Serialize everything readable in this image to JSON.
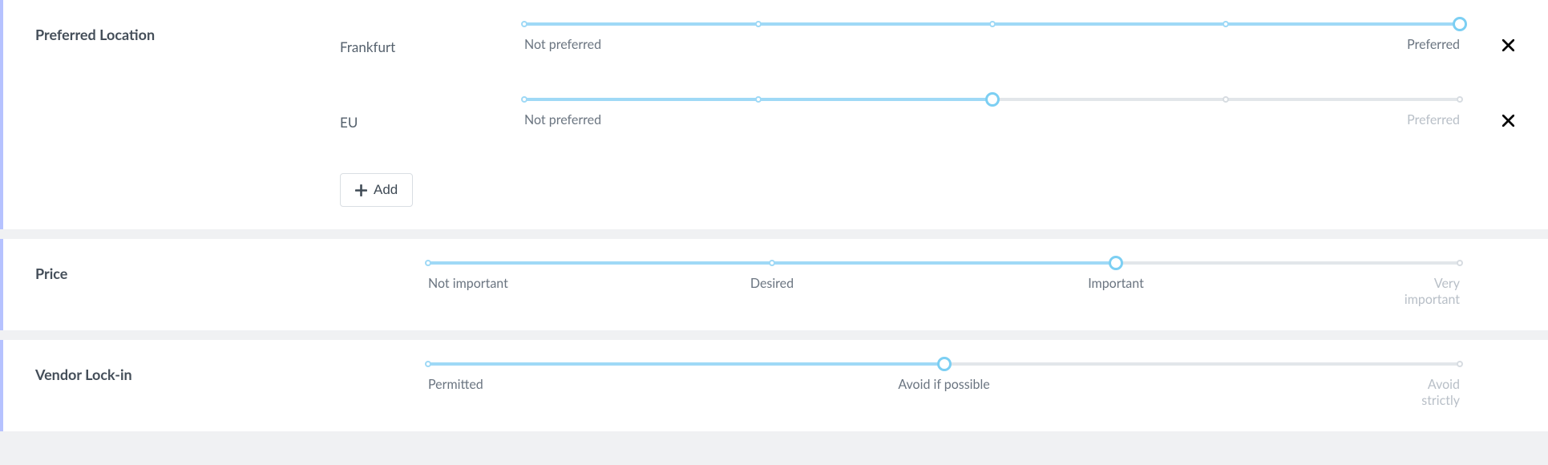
{
  "colors": {
    "slider_active": "#9fd9f6",
    "slider_inactive": "#e2e6ea",
    "card_accent": "#b6c2ff"
  },
  "location": {
    "title": "Preferred Location",
    "items": [
      {
        "name": "Frankfurt",
        "value": 4,
        "ticks": 5,
        "min_label": "Not preferred",
        "max_label": "Preferred"
      },
      {
        "name": "EU",
        "value": 2,
        "ticks": 5,
        "min_label": "Not preferred",
        "max_label": "Preferred"
      }
    ],
    "add_label": "Add"
  },
  "price": {
    "title": "Price",
    "value": 2,
    "ticks": 4,
    "labels": [
      "Not important",
      "Desired",
      "Important",
      "Very\nimportant"
    ]
  },
  "vendor": {
    "title": "Vendor Lock-in",
    "value": 1,
    "ticks": 3,
    "labels": [
      "Permitted",
      "Avoid if possible",
      "Avoid\nstrictly"
    ]
  }
}
